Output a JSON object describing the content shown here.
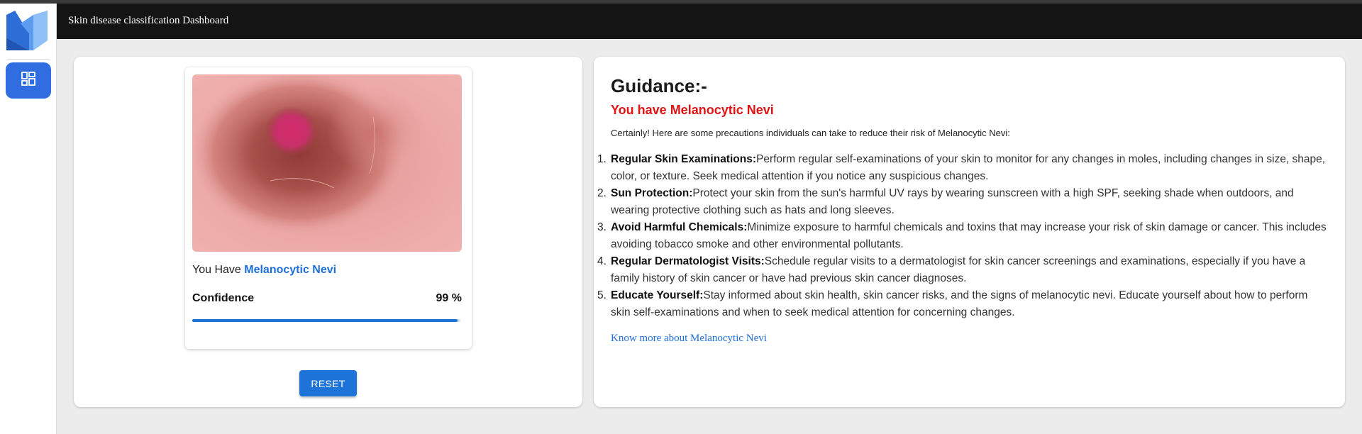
{
  "appbar": {
    "title": "Skin disease classification Dashboard"
  },
  "sidebar": {
    "logo_icon": "m-logo-icon",
    "dashboard_icon": "dashboard-icon"
  },
  "result": {
    "have_prefix": "You Have",
    "disease": "Melanocytic Nevi",
    "confidence_label": "Confidence",
    "confidence_value": "99 %",
    "confidence_fraction": 0.99
  },
  "actions": {
    "reset_label": "RESET"
  },
  "guidance": {
    "title": "Guidance:-",
    "subtitle": "You have Melanocytic Nevi",
    "intro": "Certainly! Here are some precautions individuals can take to reduce their risk of Melanocytic Nevi:",
    "items": [
      {
        "number": "1.",
        "lead": "Regular Skin Examinations:",
        "text": "Perform regular self-examinations of your skin to monitor for any changes in moles, including changes in size, shape, color, or texture. Seek medical attention if you notice any suspicious changes."
      },
      {
        "number": "2.",
        "lead": "Sun Protection:",
        "text": "Protect your skin from the sun's harmful UV rays by wearing sunscreen with a high SPF, seeking shade when outdoors, and wearing protective clothing such as hats and long sleeves."
      },
      {
        "number": "3.",
        "lead": "Avoid Harmful Chemicals:",
        "text": "Minimize exposure to harmful chemicals and toxins that may increase your risk of skin damage or cancer. This includes avoiding tobacco smoke and other environmental pollutants."
      },
      {
        "number": "4.",
        "lead": "Regular Dermatologist Visits:",
        "text": "Schedule regular visits to a dermatologist for skin cancer screenings and examinations, especially if you have a family history of skin cancer or have had previous skin cancer diagnoses."
      },
      {
        "number": "5.",
        "lead": "Educate Yourself:",
        "text": "Stay informed about skin health, skin cancer risks, and the signs of melanocytic nevi. Educate yourself about how to perform skin self-examinations and when to seek medical attention for concerning changes."
      }
    ],
    "link_text": "Know more about Melanocytic Nevi"
  },
  "colors": {
    "accent": "#1e73d8",
    "sidebar_button": "#2f6de0",
    "alert_red": "#e01313",
    "appbar_bg": "#141414",
    "page_bg": "#ececec"
  }
}
